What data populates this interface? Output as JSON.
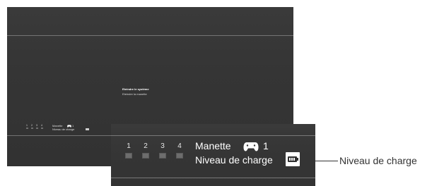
{
  "screen": {
    "menu": {
      "items": [
        "Eteindre le système",
        "Eteindre la manette"
      ],
      "selected_index": 0
    },
    "mini_status": {
      "ports": [
        "1",
        "2",
        "3",
        "4"
      ],
      "controller_label": "Manette",
      "controller_number": "1",
      "charge_label": "Niveau de charge",
      "controller_icon": "gamepad-icon",
      "battery_icon": "battery-icon"
    }
  },
  "inset": {
    "ports": [
      "1",
      "2",
      "3",
      "4"
    ],
    "controller_label": "Manette",
    "controller_number": "1",
    "charge_label": "Niveau de charge",
    "controller_icon": "gamepad-icon",
    "battery_icon": "battery-icon"
  },
  "callout": {
    "label": "Niveau de charge"
  },
  "colors": {
    "screen_background": "#353535",
    "divider_line": "#8a8a8a",
    "text": "#ffffff",
    "port_indicator": "#6d6d6d",
    "callout_text": "#333333"
  }
}
